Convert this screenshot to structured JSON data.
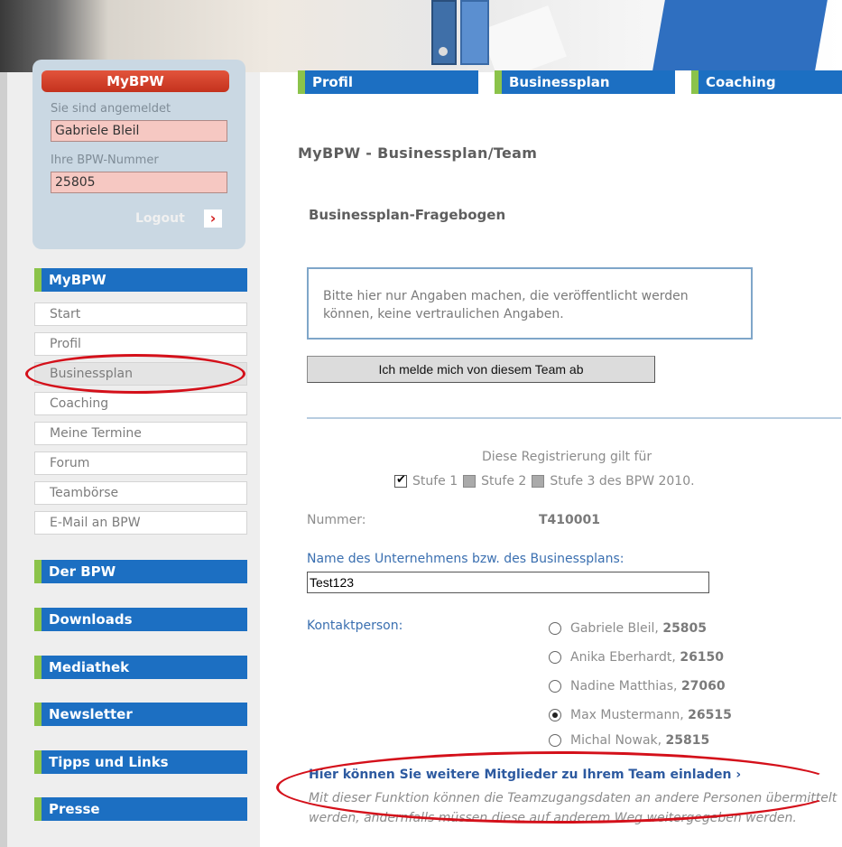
{
  "top_tabs": [
    "Profil",
    "Businessplan",
    "Coaching"
  ],
  "login": {
    "title": "MyBPW",
    "logged_in_label": "Sie sind angemeldet",
    "user_name": "Gabriele Bleil",
    "bpw_number_label": "Ihre BPW-Nummer",
    "bpw_number": "25805",
    "logout_label": "Logout",
    "logout_icon": "chevron-right-icon"
  },
  "sidebar": {
    "mybpw_header": "MyBPW",
    "items": [
      "Start",
      "Profil",
      "Businessplan",
      "Coaching",
      "Meine Termine",
      "Forum",
      "Teambörse",
      "E-Mail an BPW"
    ],
    "active_item": "Businessplan",
    "sections": [
      "Der BPW",
      "Downloads",
      "Mediathek",
      "Newsletter",
      "Tipps und Links",
      "Presse"
    ]
  },
  "main": {
    "page_title": "MyBPW - Businessplan/Team",
    "section_title": "Businessplan-Fragebogen",
    "notice": "Bitte hier nur Angaben machen, die veröffentlicht werden können, keine vertraulichen Angaben.",
    "leave_button": "Ich melde mich von diesem Team ab",
    "registration_text": "Diese Registrierung gilt für",
    "stages": [
      {
        "label": "Stufe 1",
        "checked": true
      },
      {
        "label": "Stufe 2",
        "checked": false
      },
      {
        "label": "Stufe 3 des BPW 2010.",
        "checked": false
      }
    ],
    "number_label": "Nummer:",
    "number_value": "T410001",
    "company_label": "Name des Unternehmens bzw. des Businessplans:",
    "company_value": "Test123",
    "contact_label": "Kontaktperson:",
    "contacts": [
      {
        "name": "Gabriele Bleil, ",
        "id": "25805",
        "selected": false
      },
      {
        "name": "Anika Eberhardt, ",
        "id": "26150",
        "selected": false
      },
      {
        "name": "Nadine Matthias, ",
        "id": "27060",
        "selected": false
      },
      {
        "name": "Max Mustermann, ",
        "id": "26515",
        "selected": true
      },
      {
        "name": "Michal Nowak, ",
        "id": "25815",
        "selected": false
      }
    ],
    "invite_link": "Hier können Sie weitere Mitglieder zu Ihrem Team einladen ›",
    "invite_description": "Mit dieser Funktion können die Teamzugangsdaten an andere Personen übermittelt werden, andernfalls müssen diese auf anderem Weg weitergegeben werden."
  },
  "colors": {
    "nav_blue": "#1c6fc2",
    "accent_green": "#8bc34a",
    "annotation_red": "#d4101a",
    "link_blue": "#2d5aa0"
  }
}
